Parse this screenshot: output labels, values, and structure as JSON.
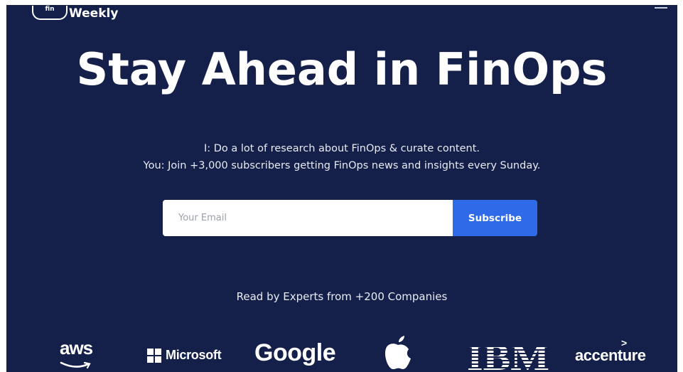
{
  "brand": {
    "name": "Weekly",
    "badge": "fin"
  },
  "hero": {
    "headline": "Stay Ahead in FinOps",
    "line1": "I: Do a lot of research about FinOps & curate content.",
    "line2": "You: Join +3,000 subscribers getting FinOps news and insights every Sunday."
  },
  "signup": {
    "email_placeholder": "Your Email",
    "email_value": "",
    "button_label": "Subscribe"
  },
  "trust": {
    "label": "Read by Experts from +200 Companies",
    "companies": [
      {
        "name": "aws",
        "icon": "aws-logo"
      },
      {
        "name": "Microsoft",
        "icon": "microsoft-logo"
      },
      {
        "name": "Google",
        "icon": "google-logo"
      },
      {
        "name": "Apple",
        "icon": "apple-logo"
      },
      {
        "name": "IBM",
        "icon": "ibm-logo"
      },
      {
        "name": "accenture",
        "icon": "accenture-logo"
      }
    ]
  },
  "colors": {
    "background": "#14204a",
    "accent": "#2f6be8",
    "text": "#ffffff"
  }
}
